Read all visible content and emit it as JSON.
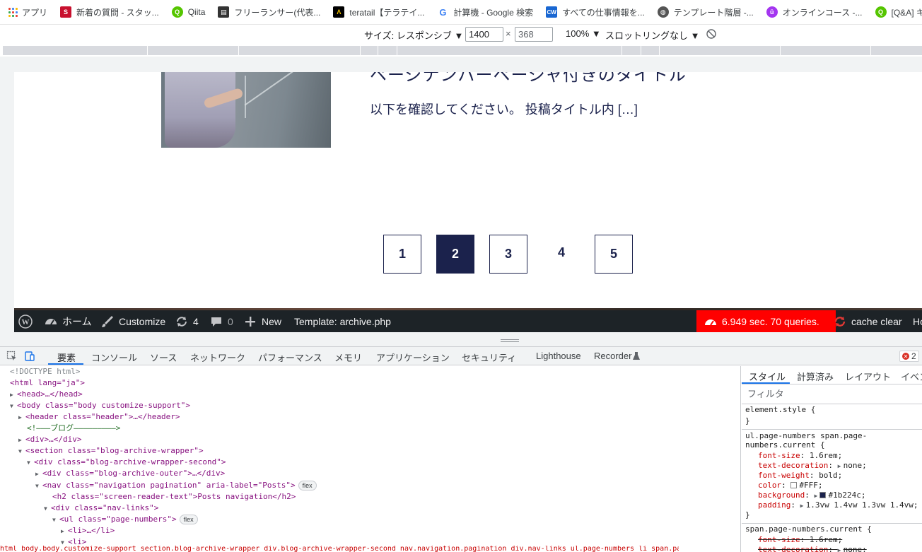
{
  "bookmarks": [
    {
      "label": "アプリ",
      "icon": "apps-grid-icon"
    },
    {
      "label": "新着の質問 - スタッ...",
      "icon": "stackoverflow-icon",
      "color": "#c8102e"
    },
    {
      "label": "Qiita",
      "icon": "qiita-icon",
      "color": "#55c500"
    },
    {
      "label": "フリーランサー(代表...",
      "icon": "trello-icon",
      "color": "#333333"
    },
    {
      "label": "teratail【テラテイ...",
      "icon": "teratail-icon",
      "color": "#000000"
    },
    {
      "label": "計算機 - Google 検索",
      "icon": "google-icon",
      "color": "#4285f4"
    },
    {
      "label": "すべての仕事情報を...",
      "icon": "crowdworks-icon",
      "color": "#1967d2"
    },
    {
      "label": "テンプレート階層 -...",
      "icon": "wordpress-globe-icon",
      "color": "#555555"
    },
    {
      "label": "オンラインコース -...",
      "icon": "udemy-icon",
      "color": "#a435f0"
    },
    {
      "label": "[Q&A] キャッシ...",
      "icon": "qiita-icon",
      "color": "#55c500"
    }
  ],
  "device_toolbar": {
    "size_label": "サイズ: レスポンシブ ▼",
    "width_value": "1400",
    "times": "×",
    "height_value": "368",
    "zoom": "100% ▼",
    "throttling": "スロットリングなし ▼"
  },
  "page": {
    "post_title": "ページナンバーページャ付きのタイトル",
    "post_excerpt": "以下を確認してください。 投稿タイトル内 […]",
    "pages": [
      "1",
      "2",
      "3",
      "4",
      "5"
    ],
    "current_page": "2"
  },
  "adminbar": {
    "home": "ホーム",
    "customize": "Customize",
    "updates_count": "4",
    "comments_count": "0",
    "new": "New",
    "template": "Template: archive.php",
    "performance": "6.949 sec. 70 queries.",
    "cache_clear": "cache clear",
    "trailing": "Ho"
  },
  "devtools": {
    "tabs": [
      "要素",
      "コンソール",
      "ソース",
      "ネットワーク",
      "パフォーマンス",
      "メモリ",
      "アプリケーション",
      "セキュリティ",
      "Lighthouse",
      "Recorder"
    ],
    "error_count": "2",
    "dom": {
      "doctype": "<!DOCTYPE html>",
      "html_open": "<html lang=\"ja\">",
      "head": "<head>…</head>",
      "body_open": "<body class=\"body customize-support\">",
      "header": "<header class=\"header\">…</header>",
      "comment": "<!–––ブログ–––––––––>",
      "div_collapsed": "<div>…</div>",
      "section": "<section class=\"blog-archive-wrapper\">",
      "div_second": "<div class=\"blog-archive-wrapper-second\">",
      "div_outer": "<div class=\"blog-archive-outer\">…</div>",
      "nav": "<nav class=\"navigation pagination\" aria-label=\"Posts\">",
      "h2": "<h2 class=\"screen-reader-text\">Posts navigation</h2>",
      "nav_links": "<div class=\"nav-links\">",
      "ul": "<ul class=\"page-numbers\">",
      "li_collapsed": "<li>…</li>",
      "li_open": "<li>",
      "flex_badge": "flex",
      "breadcrumb_tail": "html body.body.customize-support section.blog-archive-wrapper div.blog-archive-wrapper-second nav.navigation.pagination div.nav-links ul.page-numbers li span.page-numbers.current"
    },
    "styles": {
      "subtabs": [
        "スタイル",
        "計算済み",
        "レイアウト",
        "イベン"
      ],
      "filter_placeholder": "フィルタ",
      "element_style": "element.style {",
      "close_brace": "}",
      "selector1a": "ul.page-numbers span.page-",
      "selector1b": "numbers.current {",
      "props": [
        {
          "name": "font-size",
          "value": "1.6rem;"
        },
        {
          "name": "text-decoration",
          "value": "none;"
        },
        {
          "name": "font-weight",
          "value": "bold;"
        },
        {
          "name": "color",
          "value": "#FFF;"
        },
        {
          "name": "background",
          "value": "#1b224c;"
        },
        {
          "name": "padding",
          "value": "1.3vw 1.4vw 1.3vw 1.4vw;"
        }
      ],
      "selector2": "span.page-numbers.current {",
      "props2": [
        {
          "name": "font-size",
          "value": "1.6rem;"
        },
        {
          "name": "text-decoration",
          "value": "none;"
        }
      ],
      "colors": {
        "color_swatch": "#ffffff",
        "background_swatch": "#1b224c"
      }
    }
  }
}
